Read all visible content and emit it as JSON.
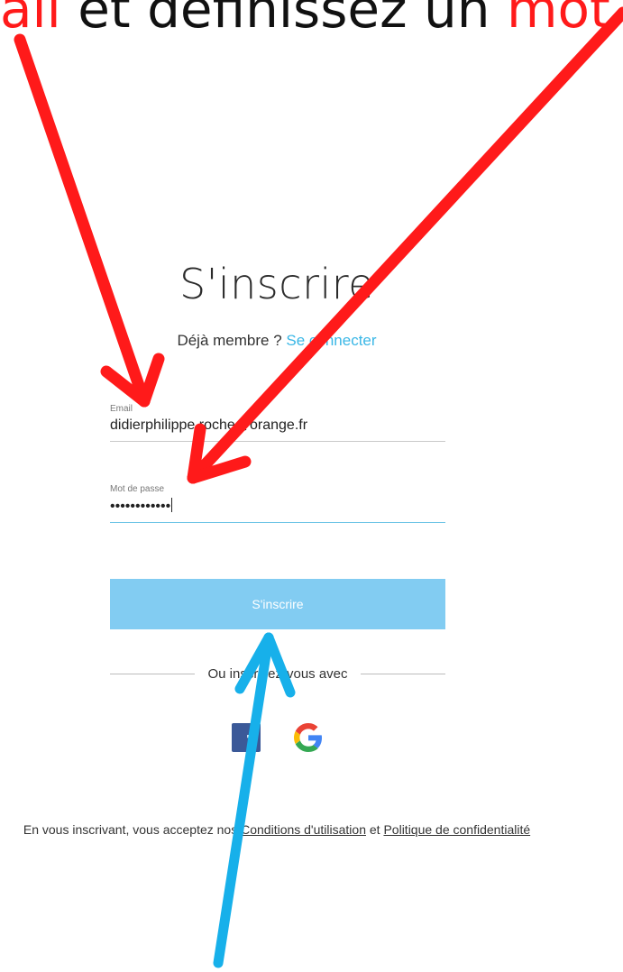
{
  "banner": {
    "part1": "ail",
    "part2": " et définissez un ",
    "part3": "mot d"
  },
  "page_title": "S'inscrire",
  "member_prompt": "Déjà membre ? ",
  "login_link": "Se connecter",
  "email": {
    "label": "Email",
    "value": "didierphilippe.roche@orange.fr"
  },
  "password": {
    "label": "Mot de passe",
    "value": "••••••••••••"
  },
  "submit_label": "S'inscrire",
  "divider_text": "Ou inscrivez-vous avec",
  "social": {
    "facebook_glyph": "f"
  },
  "legal": {
    "prefix": "En vous inscrivant, vous acceptez nos ",
    "terms": "Conditions d'utilisation",
    "conj": " et ",
    "privacy": "Politique de confidentialité"
  },
  "colors": {
    "annotation_red": "#ff1a1a",
    "annotation_blue": "#17b0ea",
    "accent": "#3ab7e6",
    "button": "#82ccf2"
  }
}
